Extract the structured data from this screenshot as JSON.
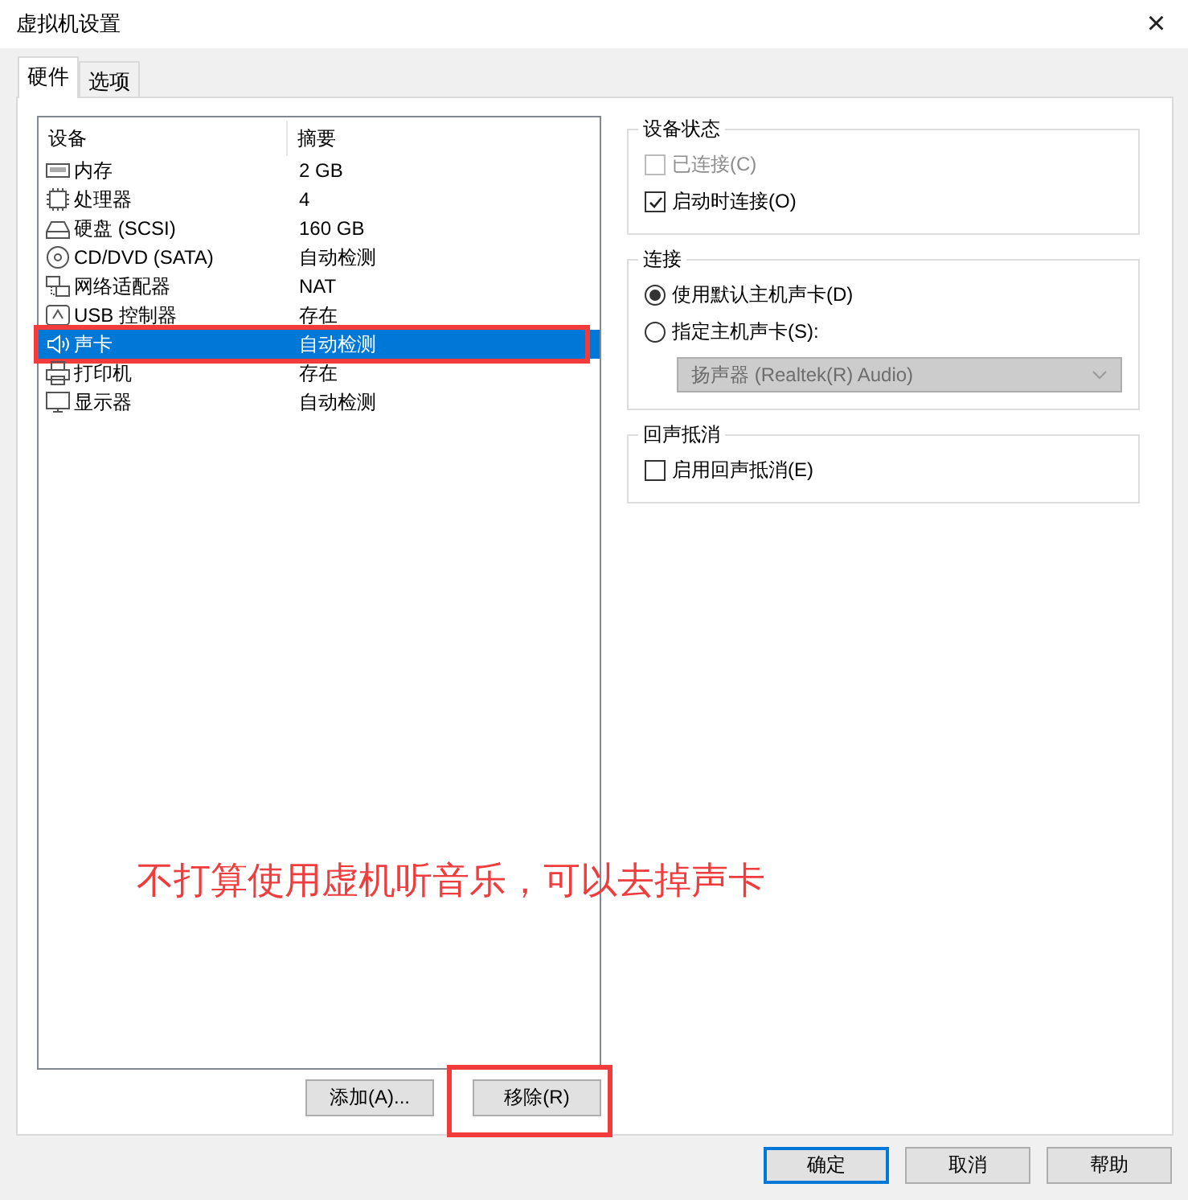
{
  "window": {
    "title": "虚拟机设置",
    "close": "×"
  },
  "tabs": [
    {
      "label": "硬件",
      "selected": true
    },
    {
      "label": "选项",
      "selected": false
    }
  ],
  "device_table": {
    "columns": [
      "设备",
      "摘要"
    ],
    "rows": [
      {
        "kind": "memory",
        "device": "内存",
        "summary": "2 GB",
        "selected": false
      },
      {
        "kind": "cpu",
        "device": "处理器",
        "summary": "4",
        "selected": false
      },
      {
        "kind": "disk",
        "device": "硬盘 (SCSI)",
        "summary": "160 GB",
        "selected": false
      },
      {
        "kind": "cdrom",
        "device": "CD/DVD (SATA)",
        "summary": "自动检测",
        "selected": false
      },
      {
        "kind": "network",
        "device": "网络适配器",
        "summary": "NAT",
        "selected": false
      },
      {
        "kind": "usb",
        "device": "USB 控制器",
        "summary": "存在",
        "selected": false
      },
      {
        "kind": "sound",
        "device": "声卡",
        "summary": "自动检测",
        "selected": true
      },
      {
        "kind": "printer",
        "device": "打印机",
        "summary": "存在",
        "selected": false
      },
      {
        "kind": "display",
        "device": "显示器",
        "summary": "自动检测",
        "selected": false
      }
    ]
  },
  "list_buttons": [
    "添加(A)...",
    "移除(R)"
  ],
  "device_status": {
    "title": "设备状态",
    "options": [
      {
        "label": "已连接(C)",
        "checked": false,
        "disabled": true
      },
      {
        "label": "启动时连接(O)",
        "checked": true,
        "disabled": false
      }
    ]
  },
  "connection": {
    "title": "连接",
    "options": [
      {
        "label": "使用默认主机声卡(D)",
        "selected": true
      },
      {
        "label": "指定主机声卡(S):",
        "selected": false
      }
    ],
    "dropdown": {
      "value": "扬声器 (Realtek(R) Audio)",
      "disabled": true
    }
  },
  "echo_cancel": {
    "title": "回声抵消",
    "options": [
      {
        "label": "启用回声抵消(E)",
        "checked": false,
        "disabled": false
      }
    ]
  },
  "annotation": {
    "caption": "不打算使用虚机听音乐，可以去掉声卡"
  },
  "footer_buttons": [
    {
      "label": "确定",
      "default": true
    },
    {
      "label": "取消",
      "default": false
    },
    {
      "label": "帮助",
      "default": false
    }
  ]
}
